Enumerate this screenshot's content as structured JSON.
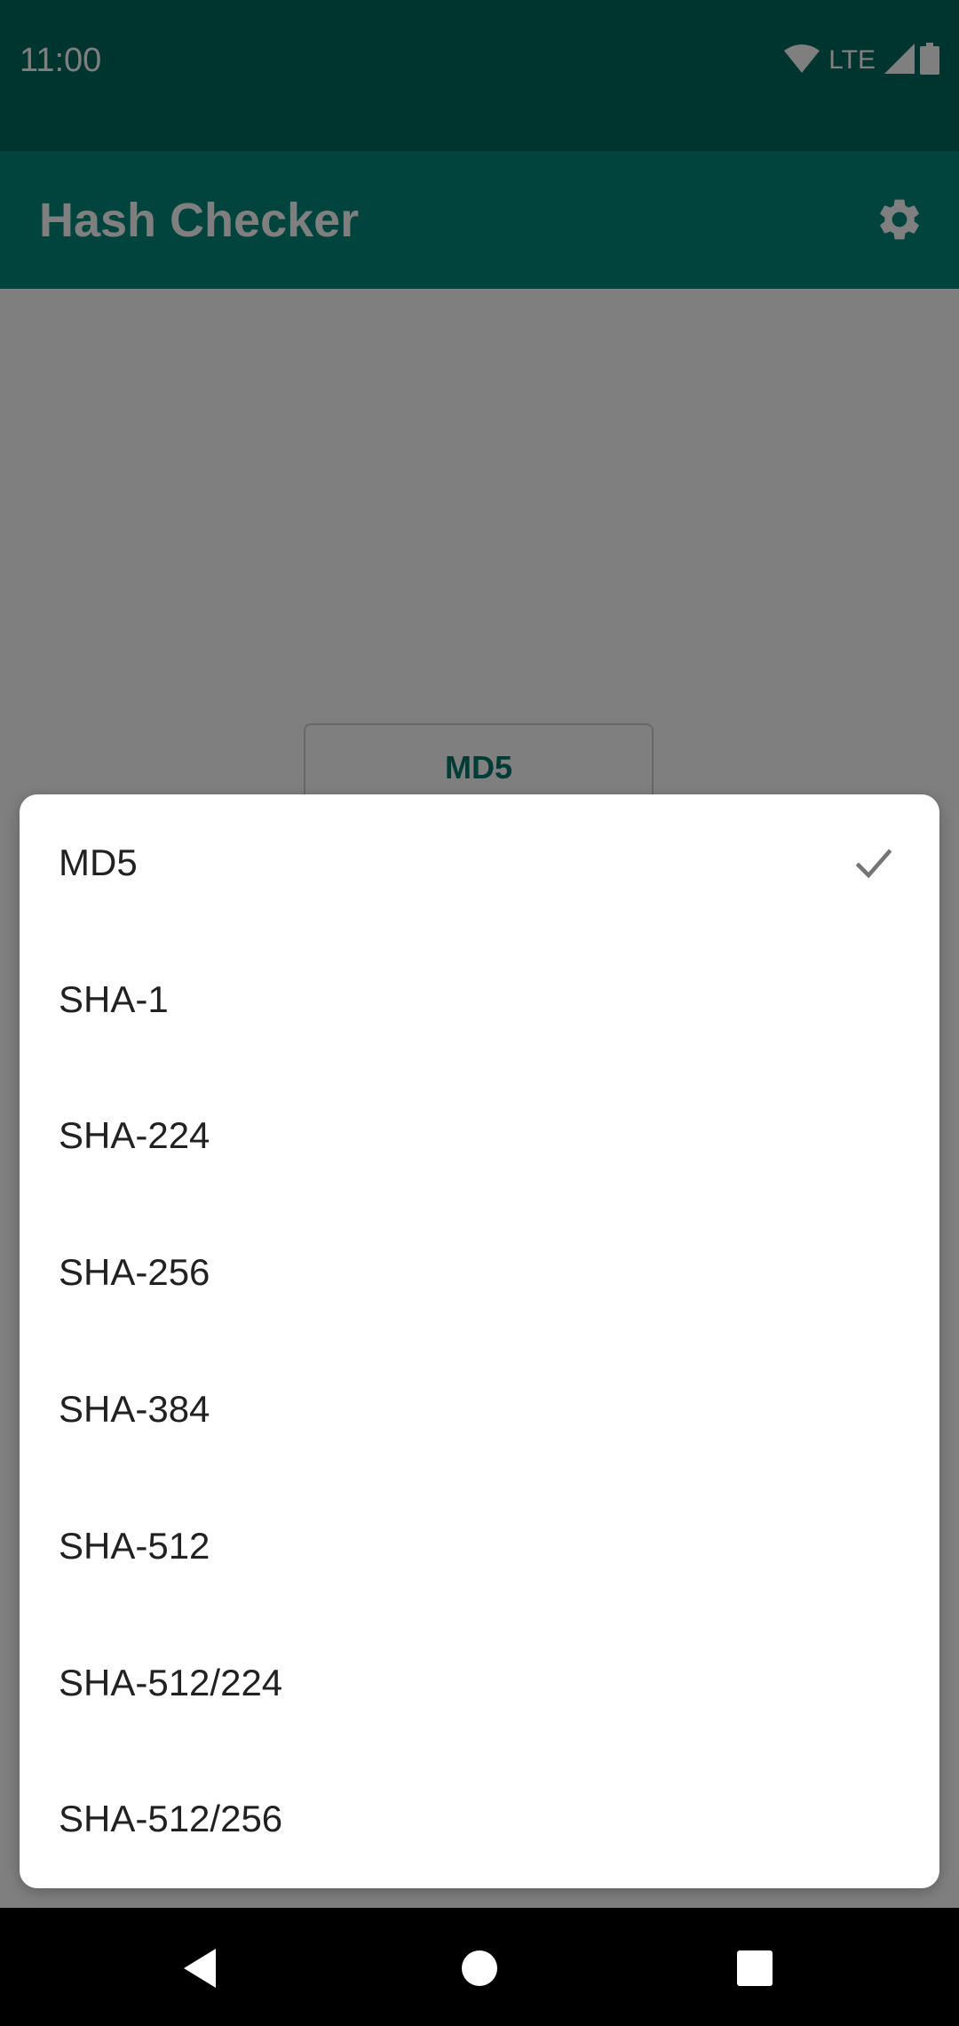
{
  "status_bar": {
    "time": "11:00",
    "network_label": "LTE",
    "icons": [
      "wifi-icon",
      "signal-icon",
      "battery-icon"
    ]
  },
  "app_bar": {
    "title": "Hash Checker",
    "settings_icon": "gear-icon"
  },
  "content": {
    "algorithm_button_label": "MD5"
  },
  "menu": {
    "selected": "MD5",
    "items": [
      {
        "label": "MD5",
        "checked": true
      },
      {
        "label": "SHA-1",
        "checked": false
      },
      {
        "label": "SHA-224",
        "checked": false
      },
      {
        "label": "SHA-256",
        "checked": false
      },
      {
        "label": "SHA-384",
        "checked": false
      },
      {
        "label": "SHA-512",
        "checked": false
      },
      {
        "label": "SHA-512/224",
        "checked": false
      },
      {
        "label": "SHA-512/256",
        "checked": false
      }
    ]
  },
  "nav_bar": {
    "buttons": [
      "back-icon",
      "home-icon",
      "recents-icon"
    ]
  },
  "colors": {
    "primary_dark": "#00695c",
    "primary": "#00897b",
    "accent_text": "#00796b",
    "menu_text": "#212121"
  }
}
